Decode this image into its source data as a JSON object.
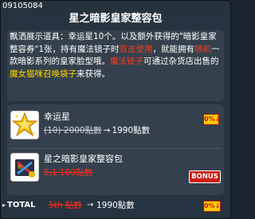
{
  "item_id": "09105084",
  "title": "星之暗影皇家整容包",
  "description": {
    "seg1": "飘洒展示道具：幸运星10个。以及额外获得的\"暗影皇家整容券\"1张，持有魔法镜子时",
    "seg2": "双击使用",
    "seg3": "，就能拥有",
    "seg4": "随机",
    "seg5": "一款暗影系列的皇家脸型哦。",
    "seg6": "魔法镜子",
    "seg7": "可通过杂货店出售的",
    "seg8": "魔女猫咪召唤袋子",
    "seg9": "来获得。"
  },
  "items": [
    {
      "name": "幸运星",
      "old_price": "(10) 2000點數",
      "new_price": "1990點數",
      "discount_badge": "0%↓"
    },
    {
      "name": "星之暗影皇家整容包",
      "old_price": "5,1 100點數",
      "bonus_badge": "BONUS"
    }
  ],
  "total": {
    "label": "TOTAL",
    "old_price": "5th 點數",
    "new_price": "1990點數",
    "discount_badge": "0%↓"
  },
  "colors": {
    "background": "#253440",
    "panel": "#34414c",
    "highlight_red": "#ff3a1f",
    "highlight_yellow": "#ffd400",
    "badge_yellow": "#ffcc00",
    "bonus_red": "#cc1d12"
  },
  "icons": {
    "lucky_star": "star-icon",
    "package": "package-icon"
  }
}
